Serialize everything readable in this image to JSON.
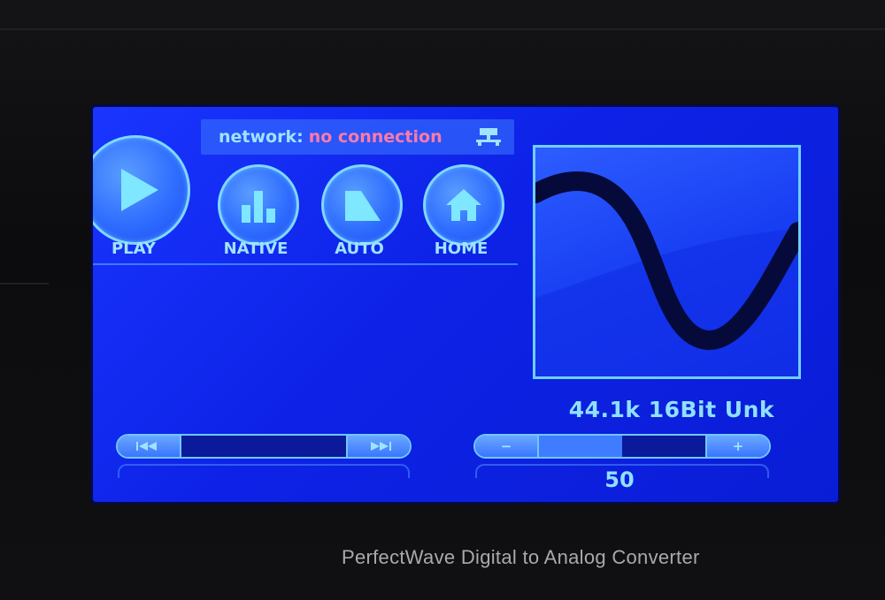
{
  "device": {
    "brand_text": "PerfectWave Digital to Analog Converter"
  },
  "network": {
    "label": "network:",
    "status": "no connection",
    "icon": "network-icon"
  },
  "controls": [
    {
      "id": "play",
      "label": "PLAY",
      "icon": "play-icon"
    },
    {
      "id": "native",
      "label": "NATIVE",
      "icon": "bar-chart-icon"
    },
    {
      "id": "auto",
      "label": "AUTO",
      "icon": "ramp-icon"
    },
    {
      "id": "home",
      "label": "HOME",
      "icon": "home-icon"
    }
  ],
  "audio": {
    "format": "44.1k 16Bit Unk"
  },
  "transport": {
    "prev_icon": "skip-back-icon",
    "next_icon": "skip-forward-icon"
  },
  "volume": {
    "value": "50",
    "minus": "−",
    "plus": "+",
    "level_fraction": 0.5
  },
  "colors": {
    "screen": "#1230f0",
    "accent": "#7fd8ff",
    "alert": "#ff7aa8"
  }
}
